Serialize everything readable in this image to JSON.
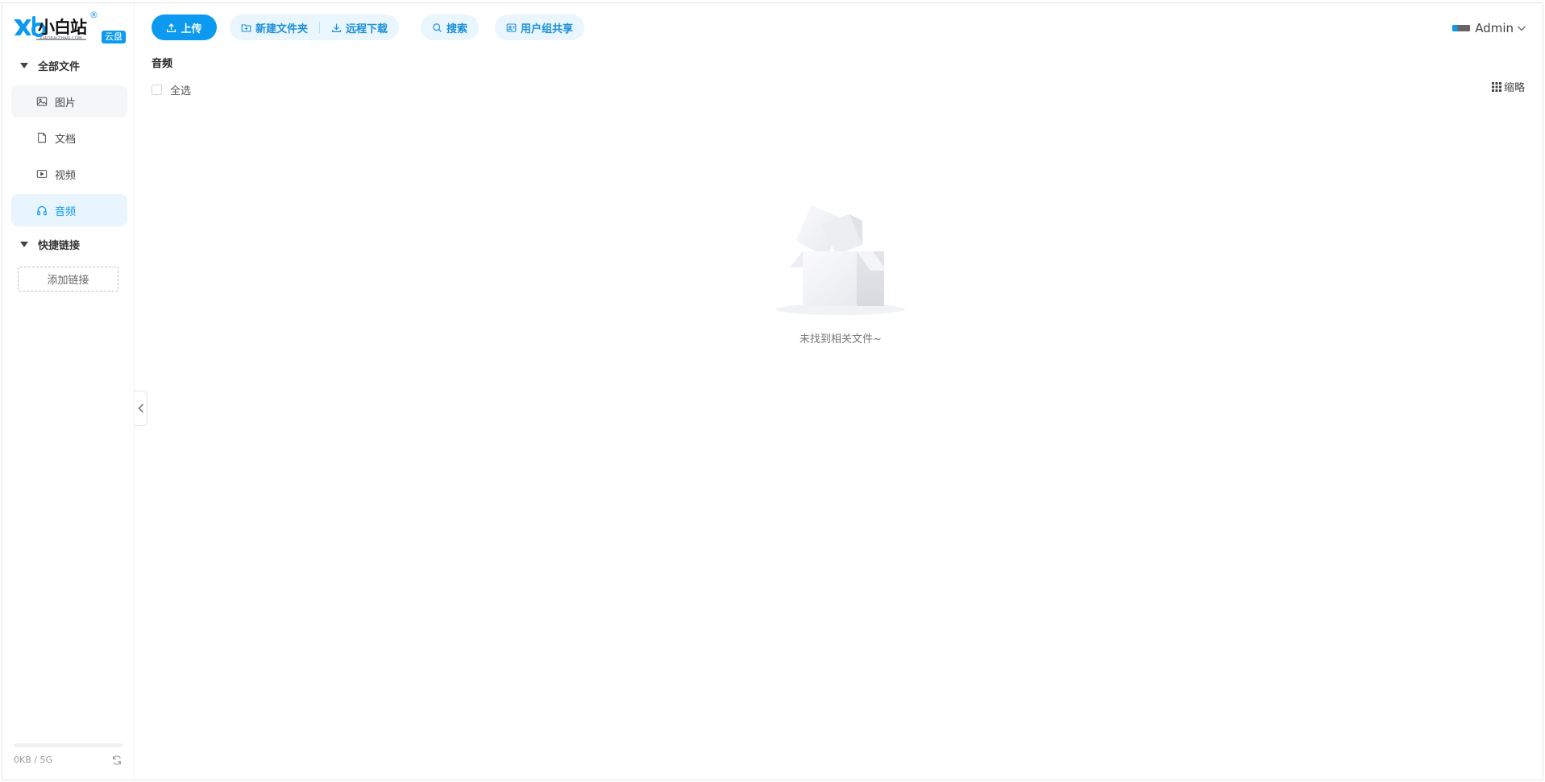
{
  "logo": {
    "wordmark": "小白站",
    "subtitle": "XIAOBAIZHAN.COM",
    "registered": "®",
    "badge": "云盘"
  },
  "sidebar": {
    "groups": [
      {
        "title": "全部文件",
        "icon": "caret-down-icon"
      },
      {
        "title": "快捷链接",
        "icon": "caret-down-icon"
      }
    ],
    "items": [
      {
        "label": "图片",
        "icon": "image-icon"
      },
      {
        "label": "文档",
        "icon": "document-icon"
      },
      {
        "label": "视频",
        "icon": "video-icon"
      },
      {
        "label": "音频",
        "icon": "headphones-icon",
        "active": true
      }
    ],
    "add_link_label": "添加链接",
    "storage": {
      "text": "0KB / 5G",
      "used_fraction": 0.0
    }
  },
  "toolbar": {
    "upload_label": "上传",
    "new_folder_label": "新建文件夹",
    "remote_download_label": "远程下载",
    "search_label": "搜索",
    "group_share_label": "用户组共享"
  },
  "user": {
    "name": "Admin"
  },
  "main": {
    "breadcrumb": "音频",
    "select_all_label": "全选",
    "view_toggle_label": "缩略",
    "empty_text": "未找到相关文件~"
  },
  "colors": {
    "accent": "#0b9af0",
    "accent_soft": "#eaf6fe",
    "active_bg": "#e8f5fe",
    "hover_bg": "#f5f6f8"
  }
}
